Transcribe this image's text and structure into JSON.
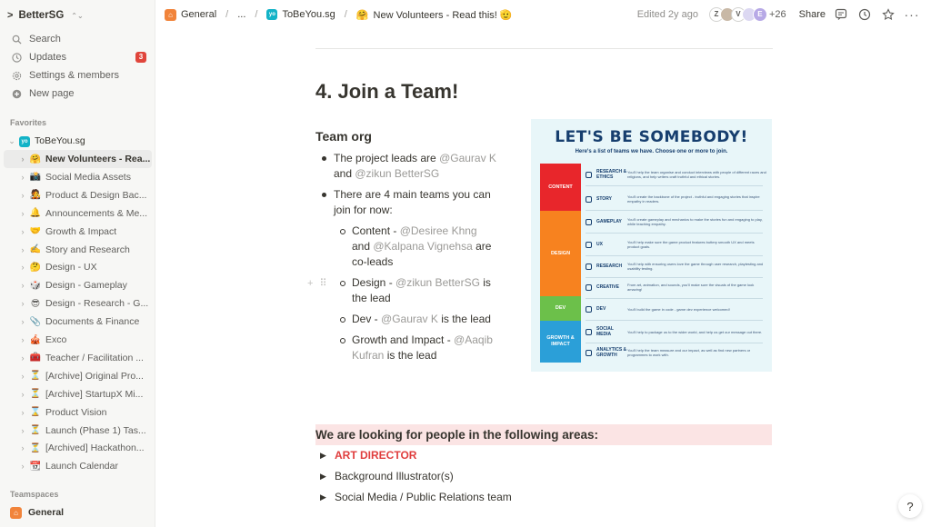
{
  "workspace": {
    "name": "BetterSG"
  },
  "sidebar": {
    "nav": [
      {
        "label": "Search",
        "icon": "search-icon"
      },
      {
        "label": "Updates",
        "icon": "clock-icon",
        "badge": "3"
      },
      {
        "label": "Settings & members",
        "icon": "gear-icon"
      },
      {
        "label": "New page",
        "icon": "plus-circle-icon"
      }
    ],
    "favorites_label": "Favorites",
    "favorites_root": "ToBeYou.sg",
    "tree": [
      {
        "emoji": "🤗",
        "label": "New Volunteers - Rea...",
        "active": true
      },
      {
        "emoji": "📸",
        "label": "Social Media Assets"
      },
      {
        "emoji": "🧑‍🎤",
        "label": "Product & Design Bac..."
      },
      {
        "emoji": "🔔",
        "label": "Announcements & Me..."
      },
      {
        "emoji": "🤝",
        "label": "Growth & Impact"
      },
      {
        "emoji": "✍️",
        "label": "Story and Research"
      },
      {
        "emoji": "🤔",
        "label": "Design - UX"
      },
      {
        "emoji": "🎲",
        "label": "Design - Gameplay"
      },
      {
        "emoji": "😎",
        "label": "Design - Research - G..."
      },
      {
        "emoji": "📎",
        "label": "Documents & Finance"
      },
      {
        "emoji": "🎪",
        "label": "Exco"
      },
      {
        "emoji": "🧰",
        "label": "Teacher / Facilitation ..."
      },
      {
        "emoji": "⏳",
        "label": "[Archive] Original Pro..."
      },
      {
        "emoji": "⏳",
        "label": "[Archive] StartupX Mi..."
      },
      {
        "emoji": "⌛",
        "label": "Product Vision"
      },
      {
        "emoji": "⏳",
        "label": "Launch (Phase 1) Tas..."
      },
      {
        "emoji": "⏳",
        "label": "[Archived] Hackathon..."
      },
      {
        "emoji": "📆",
        "label": "Launch Calendar"
      }
    ],
    "teamspaces_label": "Teamspaces",
    "teamspace": "General"
  },
  "breadcrumb": {
    "items": [
      "General",
      "...",
      "ToBeYou.sg",
      "New Volunteers - Read this! 🫡"
    ]
  },
  "topbar": {
    "edited": "Edited 2y ago",
    "avatars": [
      "Z",
      "",
      "V",
      "",
      "E"
    ],
    "more_count": "+26",
    "share": "Share"
  },
  "page": {
    "heading": "4. Join a Team!",
    "team_org": "Team org",
    "b1_pre": "The project leads are ",
    "b1_m1": "@Gaurav K",
    "b1_mid": " and ",
    "b1_m2": "@zikun BetterSG",
    "b2": "There are 4 main teams you can join for now:",
    "c_pre": "Content - ",
    "c_m1": "@Desiree Khng",
    "c_mid": " and ",
    "c_m2": "@Kalpana Vignehsa",
    "c_post": "  are co-leads",
    "d_pre": "Design - ",
    "d_m": "@zikun BetterSG",
    "d_post": " is the lead",
    "dv_pre": "Dev - ",
    "dv_m": "@Gaurav K",
    "dv_post": "  is the lead",
    "g_pre": "Growth and Impact - ",
    "g_m": "@Aaqib Kufran",
    "g_post": " is the lead",
    "callout": "We are looking for people in the following areas:",
    "toggles": [
      "ART DIRECTOR",
      "Background Illustrator(s)",
      "Social Media / Public Relations team"
    ]
  },
  "poster": {
    "title": "LET'S BE SOMEBODY!",
    "subtitle": "Here's a list of teams we have. Choose one or more to join.",
    "categories": [
      {
        "label": "CONTENT",
        "color": "#e8262b"
      },
      {
        "label": "DESIGN",
        "color": "#f7821f"
      },
      {
        "label": "DEV",
        "color": "#6cc04a"
      },
      {
        "label": "GROWTH & IMPACT",
        "color": "#2b9fd8"
      }
    ],
    "rows": [
      {
        "name": "RESEARCH & ETHICS",
        "desc": "You'll help the team organise and conduct interviews with people of different races and religions, and help writers craft truthful and ethical stories."
      },
      {
        "name": "STORY",
        "desc": "You'll create the backbone of the project - truthful and engaging stories that inspire empathy in readers."
      },
      {
        "name": "GAMEPLAY",
        "desc": "You'll create gameplay and mechanics to make the stories fun and engaging to play, while teaching empathy."
      },
      {
        "name": "UX",
        "desc": "You'll help make sure the game product features buttery smooth UX and meets product goals."
      },
      {
        "name": "RESEARCH",
        "desc": "You'll help with ensuring users love the game through user research, playtesting and usability testing."
      },
      {
        "name": "CREATIVE",
        "desc": "From art, animation, and sounds, you'll make sure the visuals of the game look amazing!"
      },
      {
        "name": "DEV",
        "desc": "You'll build the game in code - game dev experience welcomed!"
      },
      {
        "name": "SOCIAL MEDIA",
        "desc": "You'll help to package us to the wider world, and help us get our message out there."
      },
      {
        "name": "ANALYTICS & GROWTH",
        "desc": "You'll help the team measure and our impact, as well as find new partners or programmes to work with."
      }
    ]
  },
  "colors": {
    "accent_red": "#e03e3e",
    "callout_bg": "#fbe4e4",
    "sidebar_bg": "#f7f7f5"
  },
  "help": "?"
}
